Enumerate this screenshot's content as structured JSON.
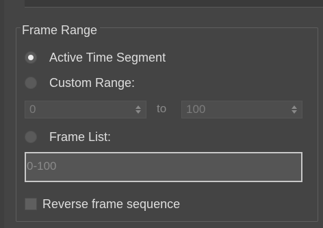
{
  "frame_range": {
    "title": "Frame Range",
    "options": [
      {
        "label": "Active Time Segment",
        "selected": true
      },
      {
        "label": "Custom Range:",
        "selected": false
      },
      {
        "label": "Frame List:",
        "selected": false
      }
    ],
    "range_start": "0",
    "range_to_label": "to",
    "range_end": "100",
    "frame_list_value": "0-100",
    "reverse_label": "Reverse frame sequence",
    "reverse_checked": false
  },
  "icons": {
    "spinner_arrows": "up-down-arrows-icon"
  },
  "colors": {
    "background": "#444444",
    "text": "#dedede",
    "disabled_text": "#7c7c7c",
    "input_border_focus": "#c9c9c9"
  }
}
